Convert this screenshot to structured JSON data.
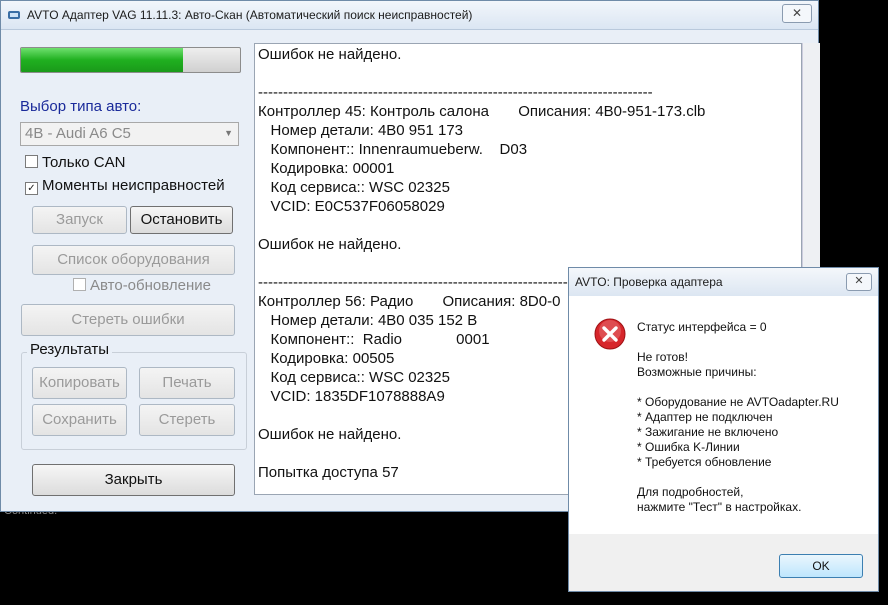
{
  "window": {
    "title": "AVTO Адаптер VAG 11.11.3:  Авто-Скан (Автоматический поиск неисправностей)",
    "close_glyph": "✕"
  },
  "left": {
    "progress_percent": 74,
    "car_type_label": "Выбор типа авто:",
    "car_type_value": "4B - Audi A6 C5",
    "only_can_label": "Только CAN",
    "only_can_checked": false,
    "freeze_frames_label": "Моменты неисправностей",
    "freeze_frames_checked": true,
    "start_button": "Запуск",
    "stop_button": "Остановить",
    "equipment_list_button": "Список оборудования",
    "auto_update_label": "Авто-обновление",
    "clear_errors_button": "Стереть ошибки",
    "results_group_label": "Результаты",
    "copy_button": "Копировать",
    "print_button": "Печать",
    "save_button": "Сохранить",
    "erase_button": "Стереть",
    "close_button": "Закрыть"
  },
  "log": {
    "lines": [
      "Ошибок не найдено.",
      "",
      "-------------------------------------------------------------------------------",
      "Контроллер 45: Контроль салона       Описания: 4B0-951-173.clb",
      "   Номер детали: 4B0 951 173",
      "   Компонент:: Innenraumueberw.    D03",
      "   Кодировка: 00001",
      "   Код сервиса:: WSC 02325",
      "   VCID: E0C537F06058029",
      "",
      "Ошибок не найдено.",
      "",
      "-------------------------------------------------------------------------------",
      "Контроллер 56: Радио       Описания: 8D0-0",
      "   Номер детали: 4B0 035 152 B",
      "   Компонент::  Radio             0001",
      "   Кодировка: 00505",
      "   Код сервиса:: WSC 02325",
      "   VCID: 1835DF1078888A9",
      "",
      "Ошибок не найдено.",
      "",
      "Попытка доступа 57"
    ]
  },
  "dialog": {
    "title": "AVTO: Проверка адаптера",
    "close_glyph": "✕",
    "status": "Статус интерфейса = 0",
    "not_ready": "Не готов!",
    "reasons_header": "Возможные причины:",
    "reasons": [
      "* Оборудование не AVTOadapter.RU",
      "* Адаптер не подключен",
      "* Зажигание не включено",
      "* Ошибка K-Линии",
      "* Требуется обновление"
    ],
    "details_line1": "Для подробностей,",
    "details_line2": "нажмите \"Тест\" в настройках.",
    "ok_button": "OK"
  },
  "background_text": "Continued."
}
